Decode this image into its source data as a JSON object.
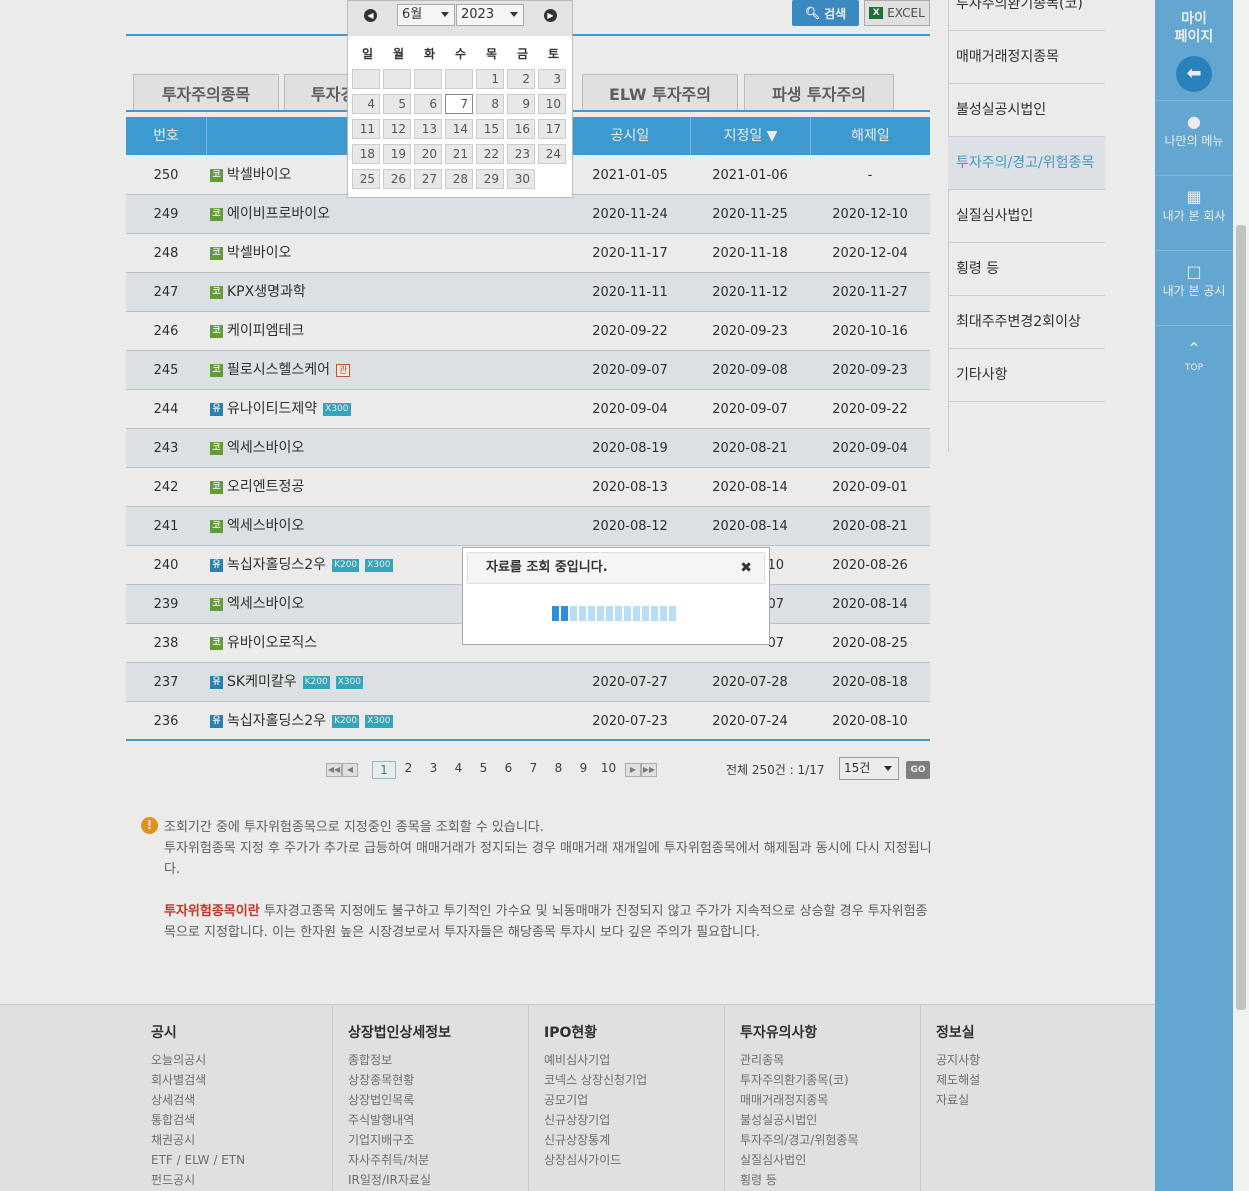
{
  "toolbar": {
    "search_label": "검색",
    "excel_label": "EXCEL"
  },
  "tabs": [
    "투자주의종목",
    "투자경",
    "ELW 투자주의",
    "파생 투자주의"
  ],
  "table": {
    "headers": [
      "번호",
      "공시일",
      "지정일 ▼",
      "해제일"
    ],
    "rows": [
      {
        "no": "250",
        "market": "코",
        "name": "박셀바이오",
        "badges": [],
        "d1": "2021-01-05",
        "d2": "2021-01-06",
        "d3": "-"
      },
      {
        "no": "249",
        "market": "코",
        "name": "에이비프로바이오",
        "badges": [],
        "d1": "2020-11-24",
        "d2": "2020-11-25",
        "d3": "2020-12-10"
      },
      {
        "no": "248",
        "market": "코",
        "name": "박셀바이오",
        "badges": [],
        "d1": "2020-11-17",
        "d2": "2020-11-18",
        "d3": "2020-12-04"
      },
      {
        "no": "247",
        "market": "코",
        "name": "KPX생명과학",
        "badges": [],
        "d1": "2020-11-11",
        "d2": "2020-11-12",
        "d3": "2020-11-27"
      },
      {
        "no": "246",
        "market": "코",
        "name": "케이피엠테크",
        "badges": [],
        "d1": "2020-09-22",
        "d2": "2020-09-23",
        "d3": "2020-10-16"
      },
      {
        "no": "245",
        "market": "코",
        "name": "필로시스헬스케어",
        "badges": [
          "관"
        ],
        "d1": "2020-09-07",
        "d2": "2020-09-08",
        "d3": "2020-09-23"
      },
      {
        "no": "244",
        "market": "유",
        "name": "유나이티드제약",
        "badges": [
          "X300"
        ],
        "d1": "2020-09-04",
        "d2": "2020-09-07",
        "d3": "2020-09-22"
      },
      {
        "no": "243",
        "market": "코",
        "name": "엑세스바이오",
        "badges": [],
        "d1": "2020-08-19",
        "d2": "2020-08-21",
        "d3": "2020-09-04"
      },
      {
        "no": "242",
        "market": "코",
        "name": "오리엔트정공",
        "badges": [],
        "d1": "2020-08-13",
        "d2": "2020-08-14",
        "d3": "2020-09-01"
      },
      {
        "no": "241",
        "market": "코",
        "name": "엑세스바이오",
        "badges": [],
        "d1": "2020-08-12",
        "d2": "2020-08-14",
        "d3": "2020-08-21"
      },
      {
        "no": "240",
        "market": "유",
        "name": "녹십자홀딩스2우",
        "badges": [
          "K200",
          "X300"
        ],
        "d1": "",
        "d2": "10",
        "d3": "2020-08-26"
      },
      {
        "no": "239",
        "market": "코",
        "name": "엑세스바이오",
        "badges": [],
        "d1": "",
        "d2": "07",
        "d3": "2020-08-14"
      },
      {
        "no": "238",
        "market": "코",
        "name": "유바이오로직스",
        "badges": [],
        "d1": "",
        "d2": "07",
        "d3": "2020-08-25"
      },
      {
        "no": "237",
        "market": "유",
        "name": "SK케미칼우",
        "badges": [
          "K200",
          "X300"
        ],
        "d1": "2020-07-27",
        "d2": "2020-07-28",
        "d3": "2020-08-18"
      },
      {
        "no": "236",
        "market": "유",
        "name": "녹십자홀딩스2우",
        "badges": [
          "K200",
          "X300"
        ],
        "d1": "2020-07-23",
        "d2": "2020-07-24",
        "d3": "2020-08-10"
      }
    ]
  },
  "pager": {
    "pages": [
      "1",
      "2",
      "3",
      "4",
      "5",
      "6",
      "7",
      "8",
      "9",
      "10"
    ],
    "current": "1",
    "total": "전체 250건 : 1/17",
    "per_page": "15건",
    "go": "GO"
  },
  "note": {
    "line1": "조회기간 중에 투자위험종목으로 지정중인 종목을 조회할 수 있습니다.",
    "line2": "투자위험종목 지정 후 주가가 추가로 급등하여 매매거래가 정지되는 경우 매매거래 재개일에 투자위험종목에서 해제됨과 동시에 다시 지정됩니다.",
    "highlight": "투자위험종목이란",
    "line3": " 투자경고종목 지정에도 불구하고 투기적인 가수요 및 뇌동매매가 진정되지 않고 주가가 지속적으로 상승할 경우 투자위험종목으로 지정합니다. 이는 한자원 높은 시장경보로서 투자자들은 해당종목 투자시 보다 깊은 주의가 필요합니다."
  },
  "side_menu": [
    "투자주의환기종목(코)",
    "매매거래정지종목",
    "불성실공시법인",
    "투자주의/경고/위험종목",
    "실질심사법인",
    "횡령 등",
    "최대주주변경2회이상",
    "기타사항"
  ],
  "quick": {
    "mypage": "마이\n페이지",
    "items": [
      "나만의 메뉴",
      "내가 본 회사",
      "내가 본 공시",
      "TOP"
    ]
  },
  "calendar": {
    "month": "6월",
    "year": "2023",
    "dow": [
      "일",
      "월",
      "화",
      "수",
      "목",
      "금",
      "토"
    ],
    "days": [
      "1",
      "2",
      "3",
      "4",
      "5",
      "6",
      "7",
      "8",
      "9",
      "10",
      "11",
      "12",
      "13",
      "14",
      "15",
      "16",
      "17",
      "18",
      "19",
      "20",
      "21",
      "22",
      "23",
      "24",
      "25",
      "26",
      "27",
      "28",
      "29",
      "30"
    ],
    "today": "7"
  },
  "loading": {
    "message": "자료를 조회 중입니다.",
    "close": "✖"
  },
  "footer": [
    {
      "title": "공시",
      "items": [
        "오늘의공시",
        "회사별검색",
        "상세검색",
        "통합검색",
        "채권공시",
        "ETF / ELW / ETN",
        "펀드공시"
      ]
    },
    {
      "title": "상장법인상세정보",
      "items": [
        "종합정보",
        "상장종목현황",
        "상장법인목록",
        "주식발행내역",
        "기업지배구조",
        "자사주취득/처분",
        "IR일정/IR자료실"
      ]
    },
    {
      "title": "IPO현황",
      "items": [
        "예비심사기업",
        "코넥스 상장신청기업",
        "공모기업",
        "신규상장기업",
        "신규상장통계",
        "상장심사가이드"
      ]
    },
    {
      "title": "투자유의사항",
      "items": [
        "관리종목",
        "투자주의환기종목(코)",
        "매매거래정지종목",
        "불성실공시법인",
        "투자주의/경고/위험종목",
        "실질심사법인",
        "횡령 등"
      ]
    },
    {
      "title": "정보실",
      "items": [
        "공지사항",
        "제도해설",
        "자료실"
      ]
    }
  ]
}
